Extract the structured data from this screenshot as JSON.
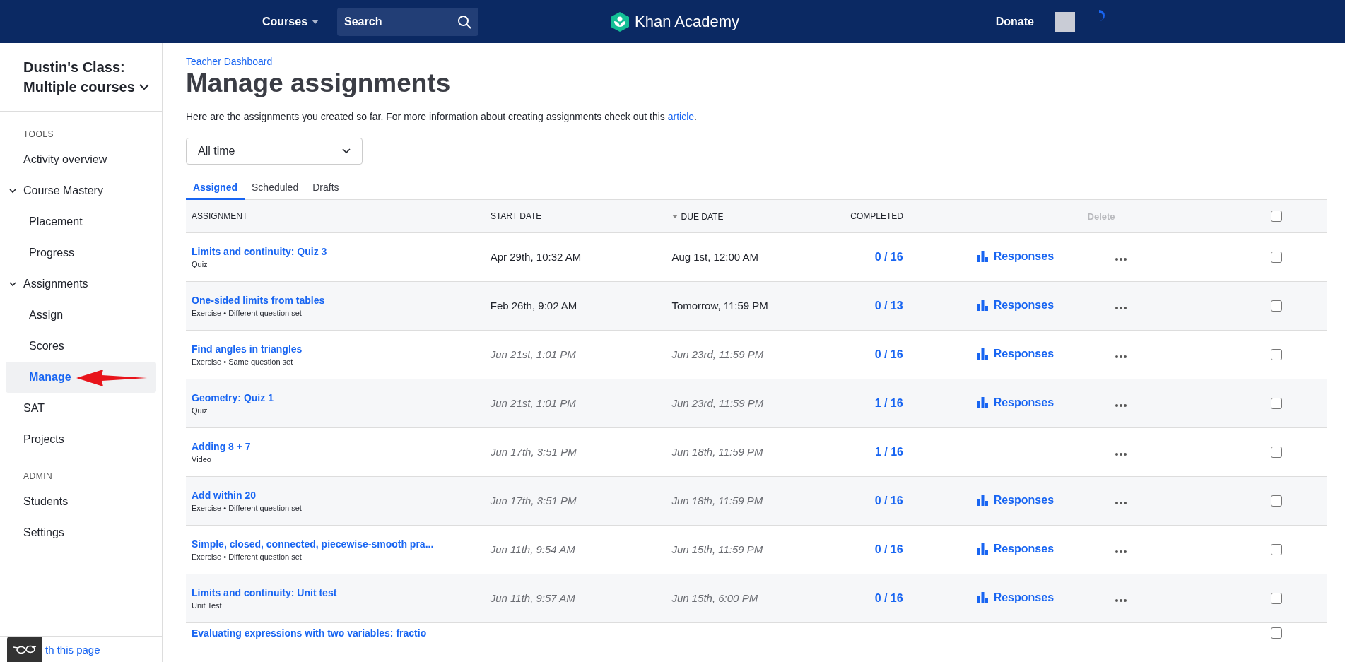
{
  "topbar": {
    "courses": "Courses",
    "search": {
      "placeholder": "Search"
    },
    "logo": "Khan Academy",
    "donate": "Donate"
  },
  "sidebar": {
    "class_title": "Dustin's Class:",
    "class_subtitle": "Multiple courses",
    "sections": [
      {
        "heading": "TOOLS",
        "items": [
          {
            "label": "Activity overview",
            "selected": false
          },
          {
            "label": "Course Mastery",
            "selected": false,
            "expanded": true,
            "children": [
              {
                "label": "Placement",
                "selected": false
              },
              {
                "label": "Progress",
                "selected": false
              }
            ]
          },
          {
            "label": "Assignments",
            "selected": false,
            "expanded": true,
            "children": [
              {
                "label": "Assign",
                "selected": false
              },
              {
                "label": "Scores",
                "selected": false
              },
              {
                "label": "Manage",
                "selected": true
              }
            ]
          },
          {
            "label": "SAT",
            "selected": false
          },
          {
            "label": "Projects",
            "selected": false
          }
        ]
      },
      {
        "heading": "ADMIN",
        "items": [
          {
            "label": "Students",
            "selected": false
          },
          {
            "label": "Settings",
            "selected": false
          }
        ]
      }
    ],
    "footer_link": "th this page"
  },
  "breadcrumb": "Teacher Dashboard",
  "title": "Manage assignments",
  "intro": "Here are the assignments you created so far. For more information about creating assignments check out this ",
  "intro_link": "article",
  "intro_end": ".",
  "filter": {
    "value": "All time"
  },
  "tabs": [
    {
      "label": "Assigned",
      "selected": true
    },
    {
      "label": "Scheduled",
      "selected": false
    },
    {
      "label": "Drafts",
      "selected": false
    }
  ],
  "table": {
    "columns": [
      "ASSIGNMENT",
      "START DATE",
      "DUE DATE",
      "COMPLETED"
    ],
    "delete": {
      "label": "Delete",
      "disabled": true
    },
    "select_all_checked": false,
    "rows": [
      {
        "title": "Limits and continuity: Quiz 3",
        "type": "Quiz",
        "start": "Apr 29th, 10:32 AM",
        "due": "Aug 1st, 12:00 AM",
        "dimmed": false,
        "completed": "0 / 16",
        "responses": "Responses",
        "checked": false
      },
      {
        "title": "One-sided limits from tables",
        "type": "Exercise • Different question set",
        "start": "Feb 26th, 9:02 AM",
        "due": "Tomorrow, 11:59 PM",
        "dimmed": false,
        "completed": "0 / 13",
        "responses": "Responses",
        "checked": false
      },
      {
        "title": "Find angles in triangles",
        "type": "Exercise • Same question set",
        "start": "Jun 21st, 1:01 PM",
        "due": "Jun 23rd, 11:59 PM",
        "dimmed": true,
        "completed": "0 / 16",
        "responses": "Responses",
        "checked": false
      },
      {
        "title": "Geometry: Quiz 1",
        "type": "Quiz",
        "start": "Jun 21st, 1:01 PM",
        "due": "Jun 23rd, 11:59 PM",
        "dimmed": true,
        "completed": "1 / 16",
        "responses": "Responses",
        "checked": false
      },
      {
        "title": "Adding 8 + 7",
        "type": "Video",
        "start": "Jun 17th, 3:51 PM",
        "due": "Jun 18th, 11:59 PM",
        "dimmed": true,
        "completed": "1 / 16",
        "checked": false
      },
      {
        "title": "Add within 20",
        "type": "Exercise • Different question set",
        "start": "Jun 17th, 3:51 PM",
        "due": "Jun 18th, 11:59 PM",
        "dimmed": true,
        "completed": "0 / 16",
        "responses": "Responses",
        "checked": false
      },
      {
        "title": "Simple, closed, connected, piecewise-smooth pra...",
        "type": "Exercise • Different question set",
        "start": "Jun 11th, 9:54 AM",
        "due": "Jun 15th, 11:59 PM",
        "dimmed": true,
        "completed": "0 / 16",
        "responses": "Responses",
        "checked": false
      },
      {
        "title": "Limits and continuity: Unit test",
        "type": "Unit Test",
        "start": "Jun 11th, 9:57 AM",
        "due": "Jun 15th, 6:00 PM",
        "dimmed": true,
        "completed": "0 / 16",
        "responses": "Responses",
        "checked": false
      },
      {
        "title": "Evaluating expressions with two variables: fractio",
        "checked": false
      }
    ]
  }
}
